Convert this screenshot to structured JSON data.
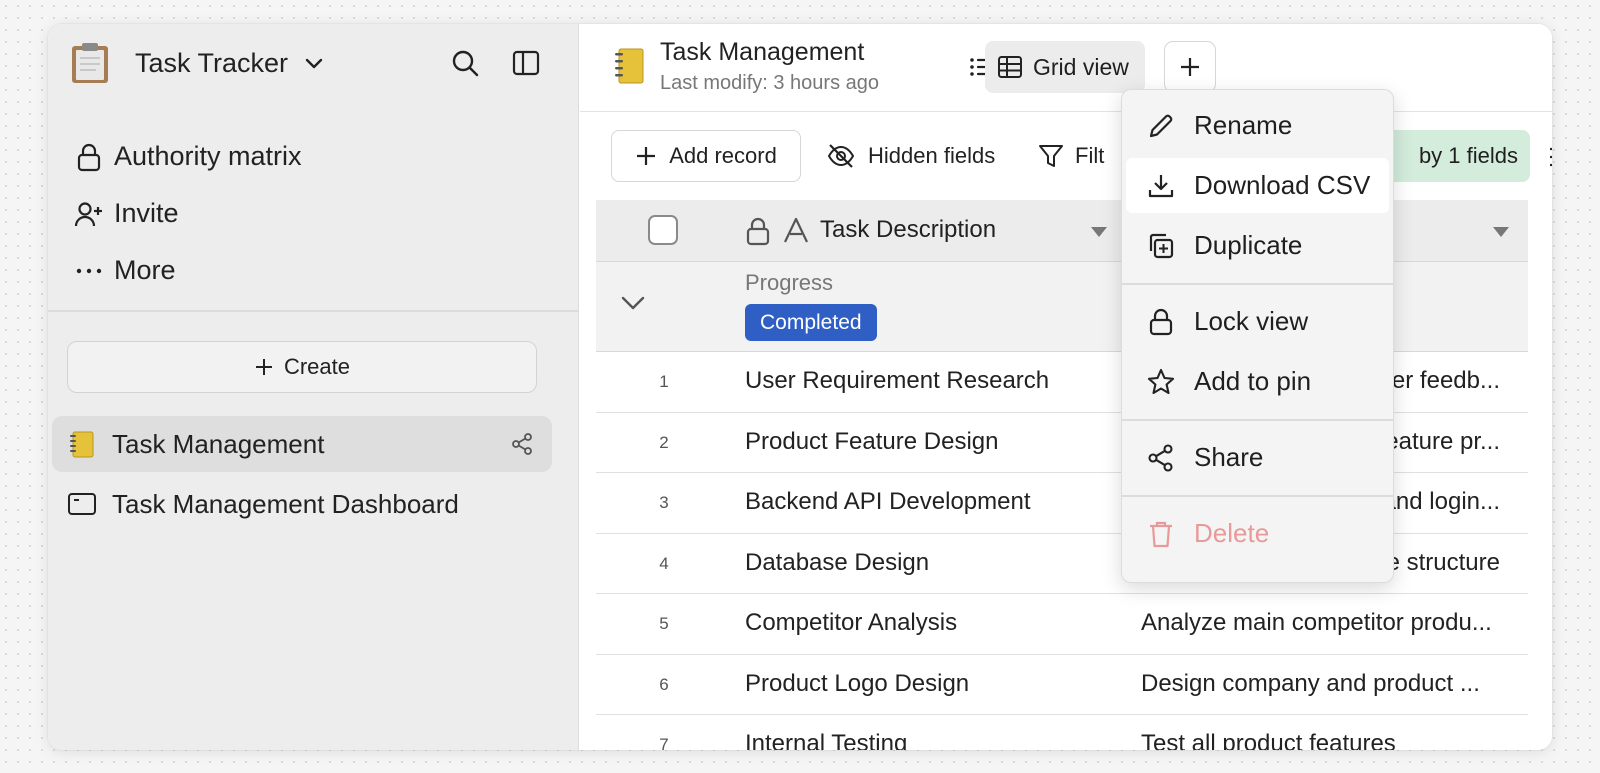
{
  "sidebar": {
    "app_title": "Task Tracker",
    "nav": [
      {
        "label": "Authority matrix",
        "icon": "lock-icon"
      },
      {
        "label": "Invite",
        "icon": "user-plus-icon"
      },
      {
        "label": "More",
        "icon": "more-dots-icon"
      }
    ],
    "create_label": "Create",
    "tables": [
      {
        "label": "Task Management",
        "icon": "notebook-icon",
        "active": true
      },
      {
        "label": "Task Management Dashboard",
        "icon": "dashboard-icon",
        "active": false
      }
    ]
  },
  "header": {
    "title": "Task Management",
    "subtitle": "Last modify: 3 hours ago",
    "view_label": "Grid view"
  },
  "toolbar": {
    "add_record": "Add record",
    "hidden_fields": "Hidden fields",
    "filter_partial": "Filt",
    "group_partial": "by 1 fields"
  },
  "grid": {
    "column_1": "Task Description",
    "group_field": "Progress",
    "group_value": "Completed",
    "group_color": "#2f5fc4",
    "rows": [
      {
        "num": "1",
        "name": "User Requirement Research",
        "desc": "ser feedb..."
      },
      {
        "num": "2",
        "name": "Product Feature Design",
        "desc": "feature pr..."
      },
      {
        "num": "3",
        "name": "Backend API Development",
        "desc": "and login..."
      },
      {
        "num": "4",
        "name": "Database Design",
        "desc": "e structure"
      },
      {
        "num": "5",
        "name": "Competitor Analysis",
        "desc": "Analyze main competitor produ..."
      },
      {
        "num": "6",
        "name": "Product Logo Design",
        "desc": "Design company and product ..."
      },
      {
        "num": "7",
        "name": "Internal Testing",
        "desc": "Test all product features"
      }
    ]
  },
  "menu": {
    "rename": "Rename",
    "download_csv": "Download CSV",
    "duplicate": "Duplicate",
    "lock_view": "Lock view",
    "add_to_pin": "Add to pin",
    "share": "Share",
    "delete": "Delete"
  },
  "colors": {
    "accent_blue": "#2f5fc4",
    "group_chip_green": "#d3ecdc",
    "delete_red": "#e89a9a"
  }
}
